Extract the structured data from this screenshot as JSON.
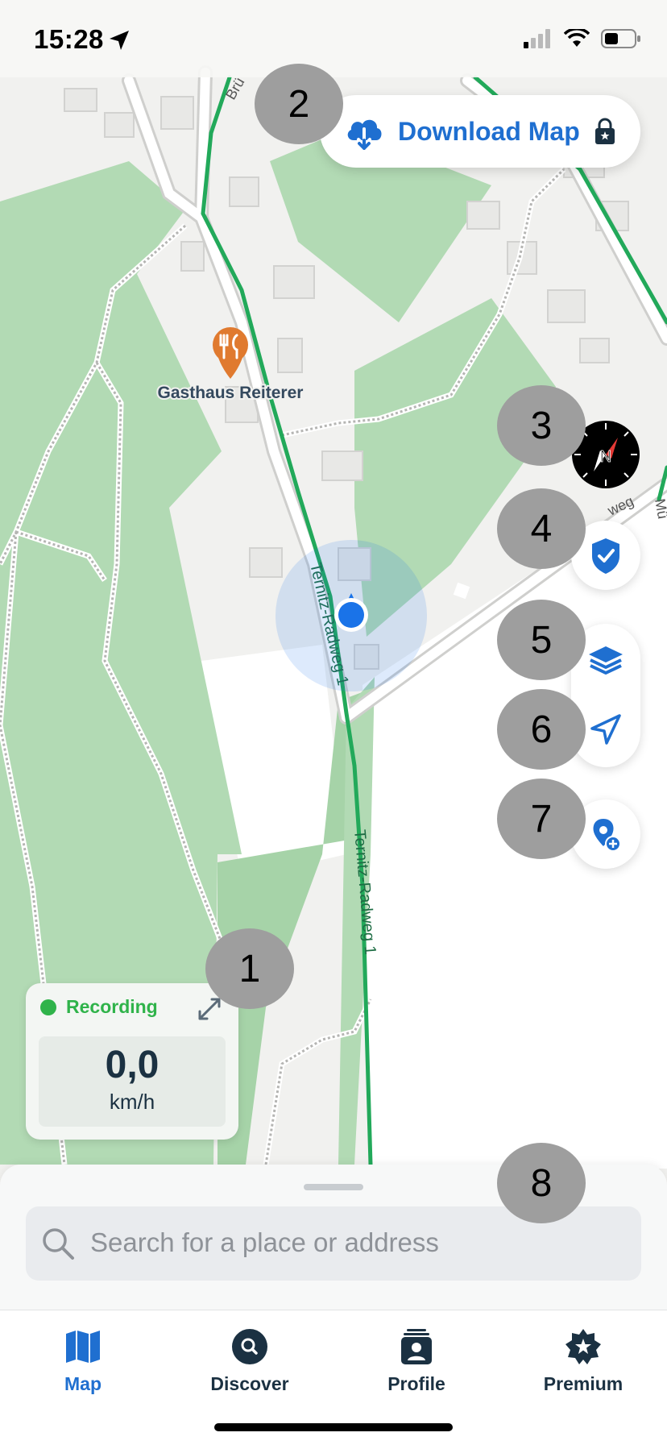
{
  "status_bar": {
    "time": "15:28",
    "icons": [
      "location-arrow-icon",
      "cellular-signal-icon",
      "wifi-icon",
      "battery-icon"
    ]
  },
  "map": {
    "poi_name": "Gasthaus Reiterer",
    "road_label_1": "Ternitz-Radweg 1",
    "road_label_2": "Ternitz-Radweg 1",
    "partial_labels": [
      "Brü",
      "Mü",
      "weg"
    ],
    "colors": {
      "route": "#22a95a",
      "forest": "#b2dab4",
      "land": "#f1f1ef",
      "poi": "#e07a2f",
      "position": "#1a73e8"
    }
  },
  "download_button": {
    "label": "Download Map",
    "icon": "cloud-download-icon",
    "badge_icon": "lock-icon"
  },
  "markers": [
    "1",
    "2",
    "3",
    "4",
    "5",
    "6",
    "7",
    "8"
  ],
  "right_controls": {
    "compass": "compass-icon",
    "buttons": [
      "shield-check-icon",
      "layers-icon",
      "navigation-arrow-icon",
      "add-location-icon"
    ]
  },
  "recording": {
    "status": "Recording",
    "speed": "0,0",
    "unit": "km/h"
  },
  "search": {
    "placeholder": "Search for a place or address"
  },
  "tabs": [
    {
      "label": "Map",
      "icon": "map-icon",
      "active": true
    },
    {
      "label": "Discover",
      "icon": "discover-search-icon",
      "active": false
    },
    {
      "label": "Profile",
      "icon": "profile-icon",
      "active": false
    },
    {
      "label": "Premium",
      "icon": "premium-badge-icon",
      "active": false
    }
  ],
  "colors": {
    "accent": "#1f6fd0",
    "recording": "#2fb34a",
    "text_dark": "#1b3142"
  }
}
